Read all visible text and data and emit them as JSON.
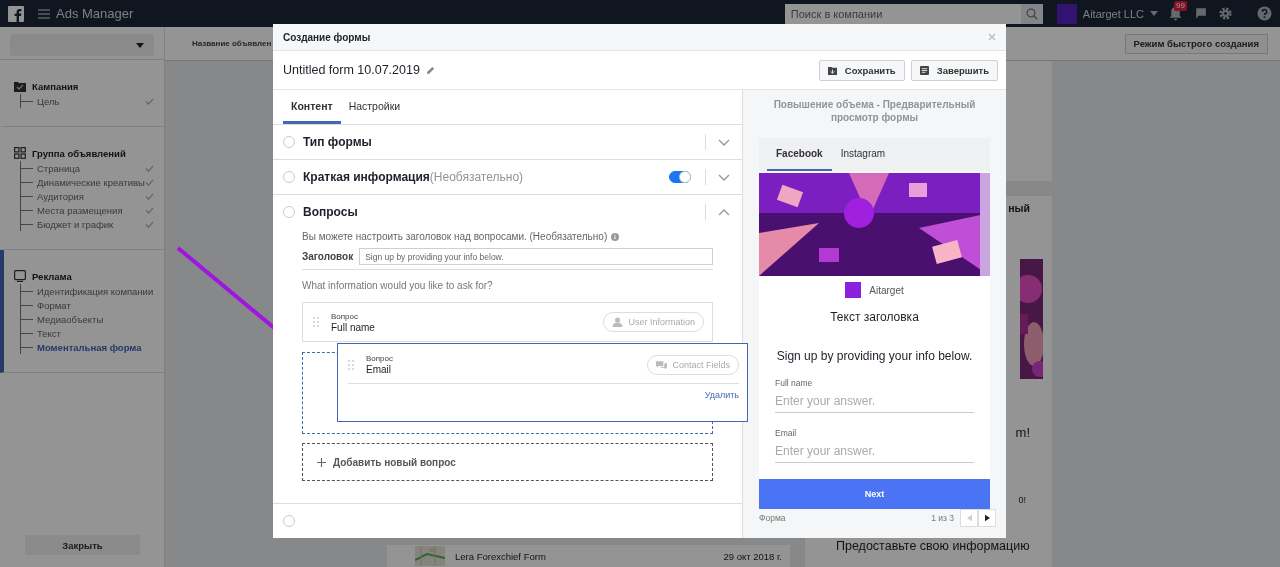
{
  "top_bar": {
    "app_name": "Ads Manager",
    "search": {
      "placeholder": "Поиск в компании"
    },
    "account": "Aitarget LLC",
    "notification_count": "99"
  },
  "sidebar": {
    "sections": [
      {
        "kind": "campaign",
        "title": "Кампания",
        "active": false,
        "children": [
          {
            "label": "Цель",
            "done": true,
            "selected": false
          }
        ]
      },
      {
        "kind": "adset",
        "title": "Группа объявлений",
        "active": false,
        "children": [
          {
            "label": "Страница",
            "done": true,
            "selected": false
          },
          {
            "label": "Динамические креативы",
            "done": true,
            "selected": false
          },
          {
            "label": "Аудитория",
            "done": true,
            "selected": false
          },
          {
            "label": "Места размещения",
            "done": true,
            "selected": false
          },
          {
            "label": "Бюджет и график",
            "done": true,
            "selected": false
          }
        ]
      },
      {
        "kind": "ad",
        "title": "Реклама",
        "active": true,
        "children": [
          {
            "label": "Идентификация компании",
            "done": false,
            "selected": false
          },
          {
            "label": "Формат",
            "done": false,
            "selected": false
          },
          {
            "label": "Медиаобъекты",
            "done": false,
            "selected": false
          },
          {
            "label": "Текст",
            "done": false,
            "selected": false
          },
          {
            "label": "Моментальная форма",
            "done": false,
            "selected": true
          }
        ]
      }
    ],
    "close_button": "Закрыть"
  },
  "toolbar": {
    "column_1": "Название объявлен",
    "quick_create_button": "Режим быстрого создания"
  },
  "background": {
    "card_fragments": [
      "ный",
      "m!",
      "0!"
    ],
    "card_text": "Предоставьте свою информацию",
    "list_row": {
      "title": "Lera Forexchief Form",
      "date": "29 окт 2018 г."
    }
  },
  "modal": {
    "title": "Создание формы",
    "form_name": "Untitled form 10.07.2019",
    "buttons": [
      {
        "kind": "save",
        "label": "Сохранить"
      },
      {
        "kind": "finish",
        "label": "Завершить"
      }
    ],
    "tabs": [
      {
        "label": "Контент",
        "selected": true
      },
      {
        "label": "Настройки",
        "selected": false
      }
    ],
    "sections": [
      {
        "title": "Тип формы",
        "checked": false,
        "expanded": false
      },
      {
        "title": "Краткая информация",
        "note": "(Необязательно)",
        "checked": false,
        "expanded": false,
        "toggle": {
          "on": true
        }
      },
      {
        "title": "Вопросы",
        "checked": false,
        "expanded": true
      }
    ],
    "hidden_section": {
      "checked": false
    },
    "questions_panel": {
      "hint": "Вы можете настроить заголовок над вопросами. (Необязательно)",
      "heading_label": "Заголовок",
      "heading_field": {
        "placeholder": "Sign up by providing your info below."
      },
      "ask_label": "What information would you like to ask for?",
      "questions": [
        {
          "label": "Вопрос",
          "value": "Full name",
          "chip": {
            "kind": "person",
            "label": "User Information"
          },
          "dragging": false
        },
        {
          "label": "Вопрос",
          "value": "Email",
          "chip": {
            "kind": "chat",
            "label": "Contact Fields"
          },
          "dragging": true,
          "delete_link": "Удалить"
        }
      ],
      "add_button": "Добавить новый вопрос"
    },
    "preview": {
      "title": "Повышение объема - Предварительный просмотр формы",
      "tabs": [
        {
          "label": "Facebook",
          "selected": true
        },
        {
          "label": "Instagram",
          "selected": false
        }
      ],
      "brand": "Aitarget",
      "headline": "Текст заголовка",
      "description": "Sign up by providing your info below.",
      "fields": [
        {
          "label": "Full name",
          "placeholder": "Enter your answer."
        },
        {
          "label": "Email",
          "placeholder": "Enter your answer."
        }
      ],
      "next_button": "Next",
      "footer_label": "Форма",
      "pager": "1 из 3",
      "prev_disabled": true,
      "next_disabled": false
    }
  }
}
